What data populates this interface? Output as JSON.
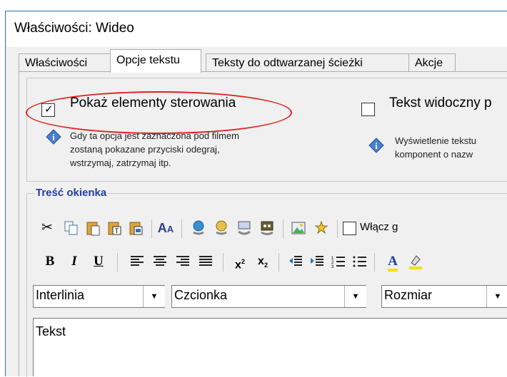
{
  "window": {
    "title": "Właściwości: Wideo"
  },
  "tabs": [
    {
      "label": "Właściwości"
    },
    {
      "label": "Opcje tekstu"
    },
    {
      "label": "Teksty do odtwarzanej ścieżki"
    },
    {
      "label": "Akcje"
    }
  ],
  "options": {
    "show_controls": {
      "label": "Pokaż elementy sterowania",
      "checked": true,
      "hint_lines": [
        "Gdy ta opcja jest zaznaczona pod filmem",
        "zostaną pokazane przyciski odegraj,",
        "wstrzymaj, zatrzymaj itp."
      ]
    },
    "text_visible": {
      "label": "Tekst widoczny p",
      "checked": false,
      "hint_lines": [
        "Wyświetlenie tekstu",
        "komponent o nazw"
      ]
    }
  },
  "content_group": {
    "legend": "Treść okienka",
    "enable_checkbox_label": "Włącz g",
    "font_combos": {
      "line": "Interlinia",
      "font": "Czcionka",
      "size": "Rozmiar"
    },
    "editor_text": "Tekst"
  },
  "toolbar_row1_icons": [
    "cut-icon",
    "copy-icon",
    "paste-icon",
    "paste-text-icon",
    "paste-word-icon",
    "find-replace-icon",
    "link-icon",
    "insert-link-icon",
    "unlink-icon",
    "anchor-icon",
    "image-icon",
    "special-icon"
  ],
  "toolbar_row2_icons": [
    "bold-icon",
    "italic-icon",
    "underline-icon",
    "align-left-icon",
    "align-center-icon",
    "align-right-icon",
    "align-justify-icon",
    "superscript-icon",
    "subscript-icon",
    "outdent-icon",
    "indent-icon",
    "numbered-list-icon",
    "bullet-list-icon",
    "font-color-icon",
    "highlight-icon"
  ],
  "colors": {
    "highlight_ring": "#e02020",
    "legend": "#1f3fa0",
    "window_border": "#2b6fbf"
  }
}
